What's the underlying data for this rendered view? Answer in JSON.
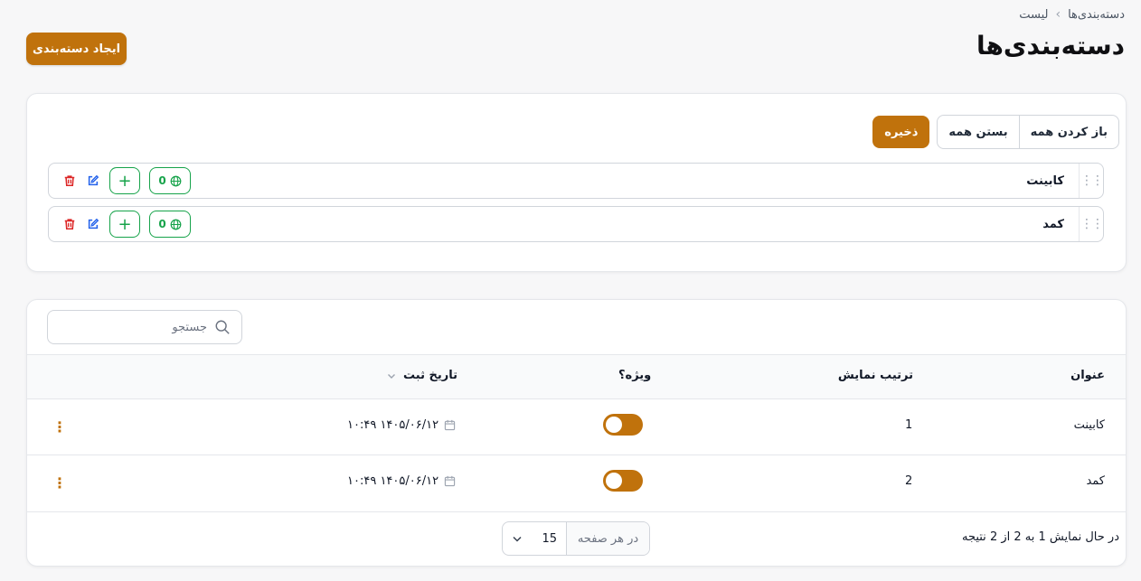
{
  "breadcrumb": {
    "parent": "دسته‌بندی‌ها",
    "current": "لیست"
  },
  "page_title": "دسته‌بندی‌ها",
  "create_button": "ایجاد دسته‌بندی",
  "tree": {
    "expand_all": "باز کردن همه",
    "collapse_all": "بستن همه",
    "save": "ذخیره",
    "items": [
      {
        "label": "کابینت",
        "count": "0"
      },
      {
        "label": "کمد",
        "count": "0"
      }
    ]
  },
  "table": {
    "search_placeholder": "جستجو",
    "columns": {
      "title": "عنوان",
      "order": "ترتیب نمایش",
      "featured": "ویژه؟",
      "created": "تاریخ ثبت"
    },
    "rows": [
      {
        "title": "کابینت",
        "order": "1",
        "featured": true,
        "created": "۱۴۰۵/۰۶/۱۲ ۱۰:۴۹"
      },
      {
        "title": "کمد",
        "order": "2",
        "featured": true,
        "created": "۱۴۰۵/۰۶/۱۲ ۱۰:۴۹"
      }
    ],
    "summary": "در حال نمایش 1 به 2 از 2 نتیجه",
    "per_page_label": "در هر صفحه",
    "per_page_value": "15"
  },
  "colors": {
    "accent": "#c0720c",
    "success": "#16a34a",
    "danger": "#dc2626",
    "edit": "#2563eb"
  }
}
